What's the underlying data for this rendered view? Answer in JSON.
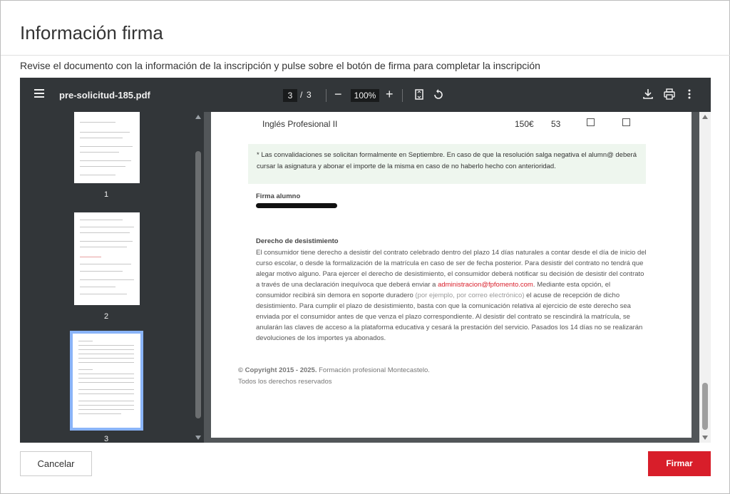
{
  "modal": {
    "title": "Información firma",
    "instruction": "Revise el documento con la información de la inscripción y pulse sobre el botón de firma para completar la inscripción"
  },
  "viewer": {
    "filename": "pre-solicitud-185.pdf",
    "current_page": "3",
    "page_separator": "/",
    "total_pages": "3",
    "zoom": "100%",
    "thumbnails": [
      {
        "label": "1"
      },
      {
        "label": "2"
      },
      {
        "label": "3",
        "selected": true
      }
    ]
  },
  "document": {
    "course_row": {
      "name": "Inglés Profesional II",
      "price": "150€",
      "hours": "53"
    },
    "note": "* Las convalidaciones se solicitan formalmente en Septiembre. En caso de que la resolución salga negativa el alumn@ deberá cursar la asignatura y abonar el importe de la misma en caso de no haberlo hecho con anterioridad.",
    "signature_label": "Firma alumno",
    "withdrawal_title": "Derecho de desistimiento",
    "withdrawal_p1": "El consumidor tiene derecho a desistir del contrato celebrado dentro del plazo 14 días naturales a contar desde el día de inicio del curso escolar, o desde la formalización de la matrícula en caso de ser de fecha posterior. Para desistir del contrato no tendrá que alegar motivo alguno. Para ejercer el derecho de desistimiento, el consumidor deberá notificar su decisión de desistir del contrato a través de una declaración inequívoca que deberá enviar a ",
    "withdrawal_email": "administracion@fpfomento.com",
    "withdrawal_p2": ". Mediante esta opción, el consumidor recibirá sin demora en soporte duradero ",
    "withdrawal_example": "(por ejemplo, por correo electrónico)",
    "withdrawal_p3": " el acuse de recepción de dicho desistimiento. Para cumplir el plazo de desistimiento, basta con que la comunicación relativa al ejercicio de este derecho sea enviada por el consumidor antes de que venza el plazo correspondiente. Al desistir del contrato se rescindirá la matrícula, se anularán las claves de acceso a la plataforma educativa y cesará la prestación del servicio. Pasados los 14 días no se realizarán devoluciones de los importes ya abonados.",
    "copyright_bold": "© Copyright 2015 - 2025.",
    "copyright_rest": " Formación profesional Montecastelo.",
    "rights": "Todos los derechos reservados"
  },
  "actions": {
    "cancel_label": "Cancelar",
    "sign_label": "Firmar"
  },
  "colors": {
    "accent": "#d81e2a",
    "toolbar": "#323639",
    "viewer_bg": "#525659",
    "thumb_selected": "#8ab4f8"
  },
  "icons": [
    "menu-icon",
    "zoom-out-icon",
    "zoom-in-icon",
    "fit-page-icon",
    "rotate-icon",
    "download-icon",
    "print-icon",
    "more-icon"
  ]
}
